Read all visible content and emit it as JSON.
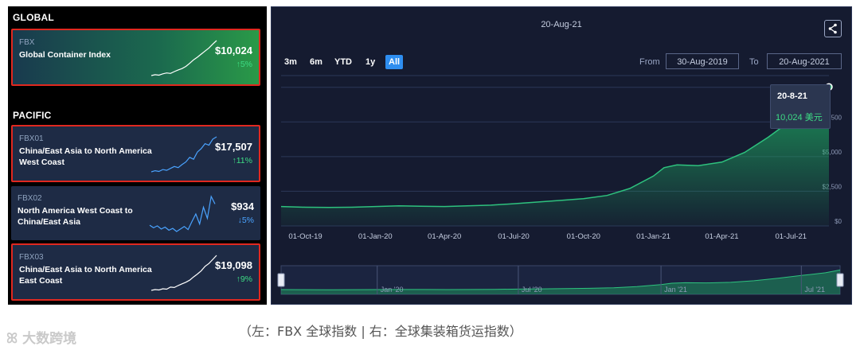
{
  "left": {
    "global_title": "GLOBAL",
    "pacific_title": "PACIFIC",
    "cards": [
      {
        "code": "FBX",
        "name": "Global Container Index",
        "price": "$10,024",
        "change": "5%",
        "direction": "up",
        "spark": [
          2,
          2.2,
          2.1,
          2.4,
          2.6,
          2.5,
          2.9,
          3.3,
          3.6,
          4.1,
          4.8,
          5.6,
          6.2,
          6.9,
          7.6,
          8.3,
          9.2,
          10.0
        ]
      },
      {
        "code": "FBX01",
        "name": "China/East Asia to North America West Coast",
        "price": "$17,507",
        "change": "11%",
        "direction": "up",
        "spark": [
          2,
          2.3,
          2.1,
          2.6,
          2.4,
          2.9,
          3.4,
          3.1,
          3.9,
          4.6,
          5.8,
          5.3,
          7.2,
          8.1,
          9.4,
          9.0,
          10.6,
          11.2
        ]
      },
      {
        "code": "FBX02",
        "name": "North America West Coast to China/East Asia",
        "price": "$934",
        "change": "5%",
        "direction": "down",
        "spark": [
          4,
          3.6,
          3.9,
          3.4,
          3.7,
          3.2,
          3.5,
          3.0,
          3.4,
          3.8,
          3.3,
          4.6,
          5.8,
          4.2,
          6.9,
          5.1,
          8.6,
          7.4
        ]
      },
      {
        "code": "FBX03",
        "name": "China/East Asia to North America East Coast",
        "price": "$19,098",
        "change": "9%",
        "direction": "up",
        "spark": [
          2,
          2.2,
          2.1,
          2.4,
          2.3,
          2.8,
          2.7,
          3.2,
          3.6,
          4.0,
          4.5,
          5.3,
          6.0,
          6.8,
          7.9,
          8.6,
          9.6,
          10.6
        ]
      }
    ]
  },
  "chart": {
    "date_label": "20-Aug-21",
    "ranges": [
      "3m",
      "6m",
      "YTD",
      "1y",
      "All"
    ],
    "active_range": "All",
    "from_label": "From",
    "to_label": "To",
    "from_date": "30-Aug-2019",
    "to_date": "20-Aug-2021",
    "tooltip_date": "20-8-21",
    "tooltip_value": "10,024 美元",
    "nav_labels": [
      "Jan '20",
      "Jul '20",
      "Jan '21",
      "Jul '21"
    ]
  },
  "chart_data": {
    "type": "area",
    "x_labels": [
      "01-Oct-19",
      "01-Jan-20",
      "01-Apr-20",
      "01-Jul-20",
      "01-Oct-20",
      "01-Jan-21",
      "01-Apr-21",
      "01-Jul-21"
    ],
    "y_ticks": [
      "$0",
      "$2,500",
      "$5,000",
      "$7,500"
    ],
    "ylim": [
      0,
      10500
    ],
    "x": [
      "2019-08-30",
      "2019-10-01",
      "2019-11-01",
      "2019-12-01",
      "2020-01-01",
      "2020-02-01",
      "2020-03-01",
      "2020-04-01",
      "2020-05-01",
      "2020-06-01",
      "2020-07-01",
      "2020-08-01",
      "2020-09-01",
      "2020-10-01",
      "2020-11-01",
      "2020-12-01",
      "2021-01-01",
      "2021-01-15",
      "2021-02-01",
      "2021-03-01",
      "2021-04-01",
      "2021-05-01",
      "2021-06-01",
      "2021-07-01",
      "2021-08-01",
      "2021-08-20"
    ],
    "values": [
      1400,
      1350,
      1330,
      1350,
      1400,
      1450,
      1420,
      1400,
      1450,
      1500,
      1600,
      1720,
      1840,
      1960,
      2200,
      2700,
      3600,
      4200,
      4400,
      4350,
      4600,
      5300,
      6400,
      7600,
      8800,
      10024
    ],
    "series": [
      {
        "name": "FBX",
        "color": "#1ea862"
      }
    ],
    "grid": true
  },
  "caption": "（左：FBX 全球指数 | 右：全球集装箱货运指数）",
  "watermark": "大数跨境",
  "colors": {
    "up": "#3ddc84",
    "down": "#4aa3ff",
    "accent": "#2e8ef0",
    "outline": "#e0281f"
  }
}
